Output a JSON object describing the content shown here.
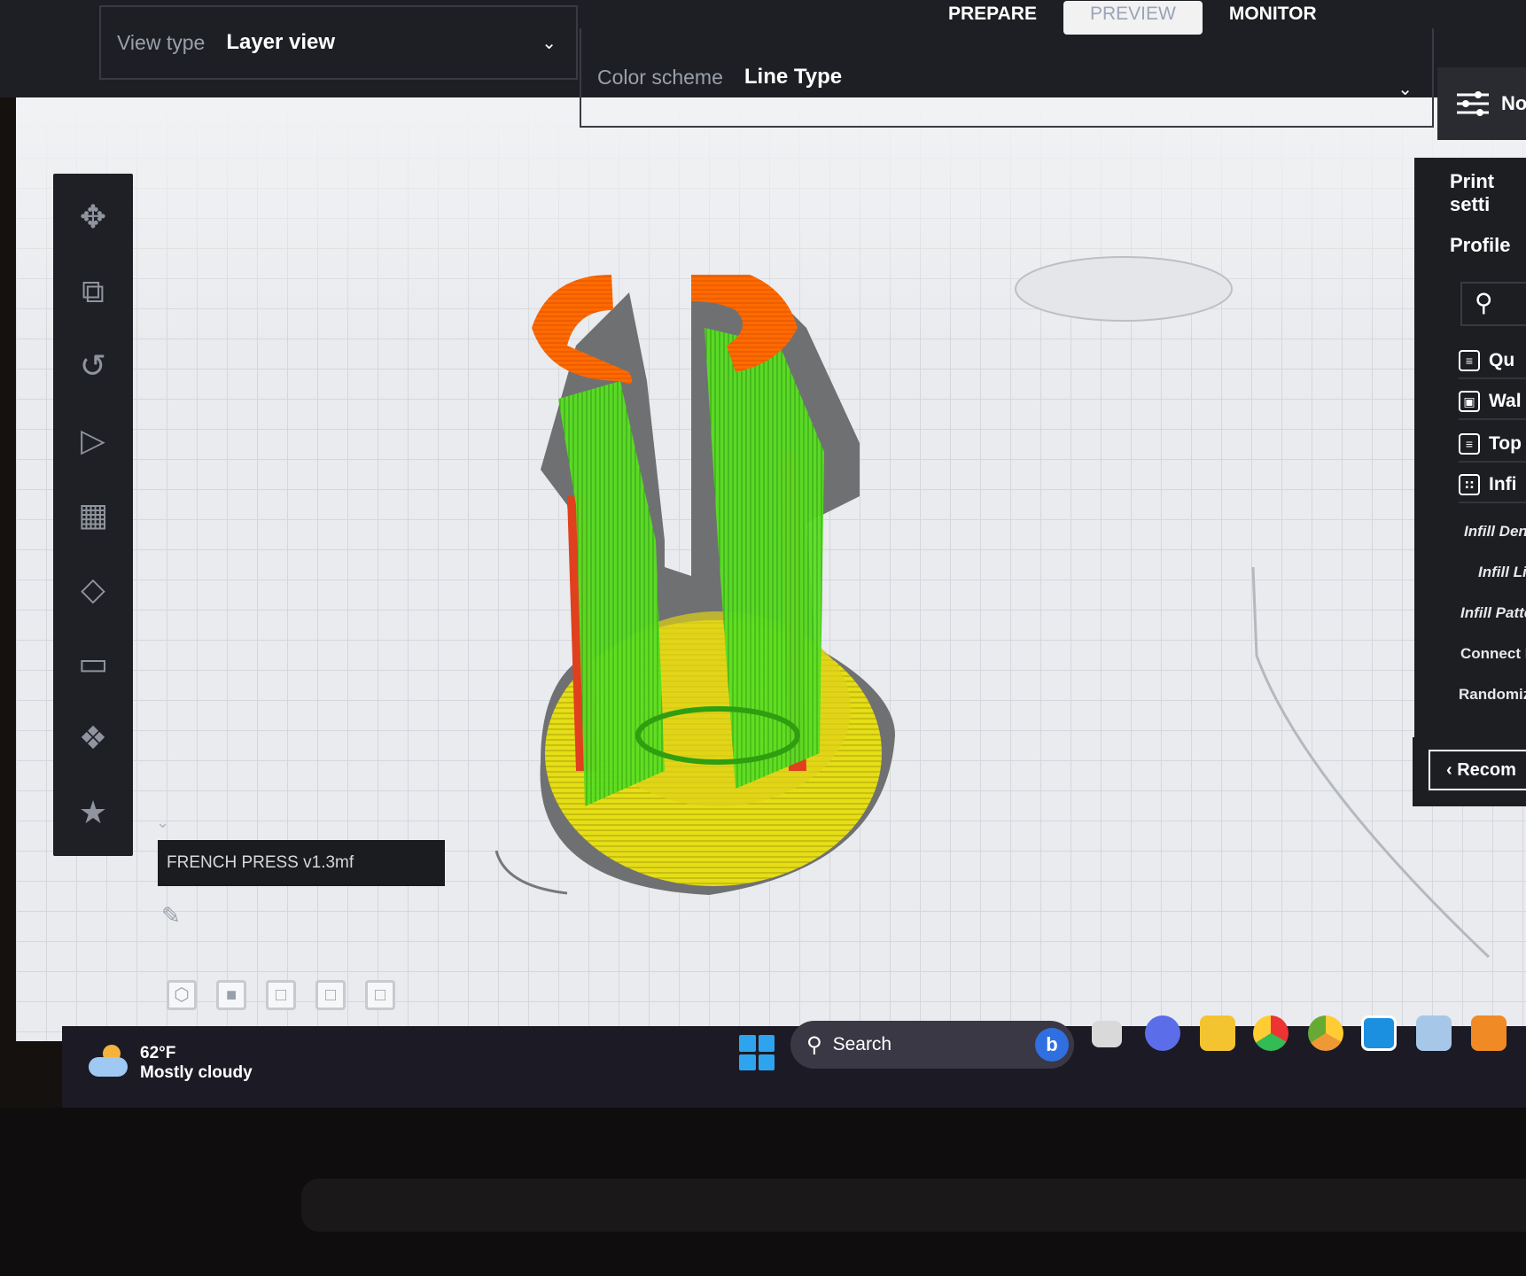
{
  "stage_tabs": [
    "PREPARE",
    "PREVIEW",
    "MONITOR"
  ],
  "view_type": {
    "label": "View type",
    "value": "Layer view"
  },
  "color_scheme": {
    "label": "Color scheme",
    "value": "Line Type"
  },
  "settings_button": {
    "label": "No"
  },
  "toolbar": {
    "tools": [
      "move-icon",
      "scale-icon",
      "rotate-icon",
      "mirror-icon",
      "per-model-settings-icon",
      "support-blocker-icon",
      "measure-icon",
      "paint-icon",
      "star-icon"
    ]
  },
  "object_list": {
    "name": "FRENCH PRESS v1.3mf"
  },
  "camera_views": [
    "3d-view",
    "front-view",
    "top-view",
    "left-view",
    "right-view"
  ],
  "print_panel": {
    "title": "Print setti",
    "profile": "Profile",
    "categories": [
      "Qu",
      "Wal",
      "Top",
      "Infi"
    ],
    "settings": [
      "Infill Dens",
      "Infill Lir",
      "Infill Patte",
      "Connect In",
      "Randomize"
    ],
    "recommended": "Recom"
  },
  "colors": {
    "outer_wall": "#ff6a00",
    "inner_wall": "#54e01e",
    "skin": "#e8e21a",
    "infill": "#e04020",
    "shell": "#6f7072"
  },
  "taskbar": {
    "weather_temp": "62°F",
    "weather_desc": "Mostly cloudy",
    "search": "Search",
    "bing": "b"
  }
}
